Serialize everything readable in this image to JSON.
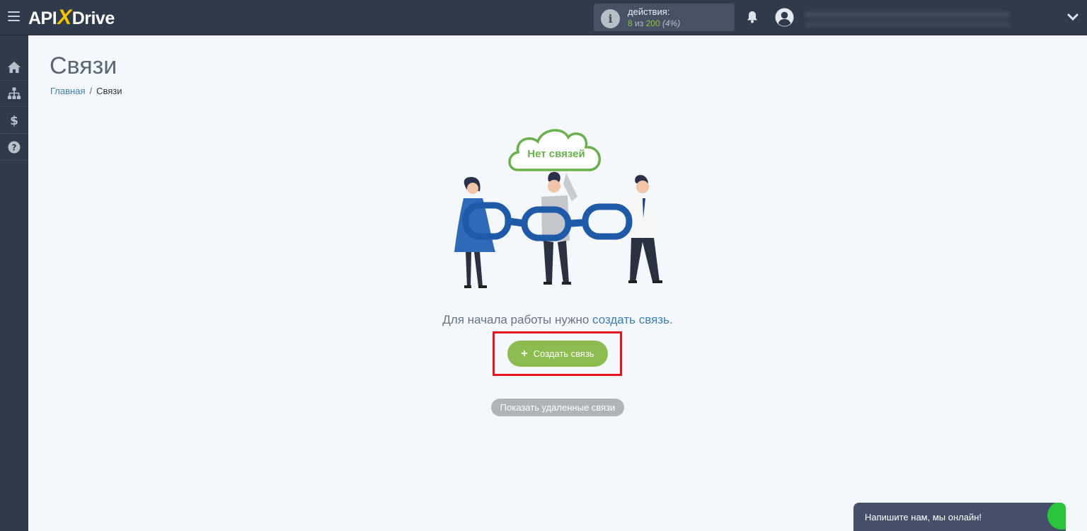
{
  "header": {
    "logo_left": "API",
    "logo_x": "X",
    "logo_right": "Drive",
    "actions_label": "действия:",
    "actions_used": "8",
    "actions_of": "из",
    "actions_total": "200",
    "actions_percent": "(4%)",
    "icons": [
      "menu-icon",
      "info-icon",
      "bell-icon",
      "user-icon",
      "chevron-down-icon"
    ]
  },
  "sidebar": {
    "items": [
      {
        "icon": "home-icon"
      },
      {
        "icon": "sitemap-icon"
      },
      {
        "icon": "dollar-icon"
      },
      {
        "icon": "help-icon"
      }
    ]
  },
  "main": {
    "title": "Связи",
    "breadcrumb": {
      "home": "Главная",
      "separator": "/",
      "current": "Связи"
    },
    "illustration_cloud_text": "Нет связей",
    "start_text": "Для начала работы нужно ",
    "start_link": "создать связь",
    "start_end": ".",
    "create_button": "Создать связь",
    "create_plus": "+",
    "show_deleted_button": "Показать удаленные связи"
  },
  "chat": {
    "label": "Напишите нам, мы онлайн!"
  },
  "colors": {
    "topbar": "#2f3a4a",
    "accent_green": "#8cbc4f",
    "link_blue": "#3b7fb6",
    "highlight_red": "#e3141c",
    "chain_blue": "#1f5aa8"
  }
}
